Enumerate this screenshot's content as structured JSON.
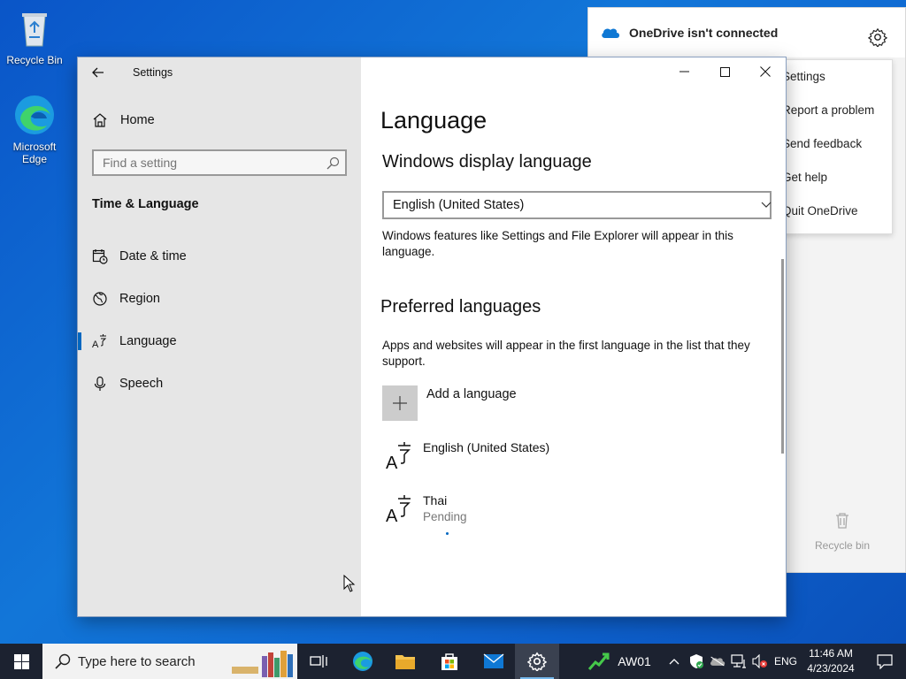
{
  "desktop": {
    "icons": [
      {
        "label": "Recycle Bin"
      },
      {
        "label_line1": "Microsoft",
        "label_line2": "Edge"
      }
    ]
  },
  "onedrive": {
    "title": "OneDrive isn't connected",
    "menu": [
      "Settings",
      "Report a problem",
      "Send feedback",
      "Get help",
      "Quit OneDrive"
    ],
    "recycle_label": "Recycle bin"
  },
  "settings": {
    "window_title": "Settings",
    "home_label": "Home",
    "search_placeholder": "Find a setting",
    "section_title": "Time & Language",
    "nav": [
      {
        "label": "Date & time",
        "icon": "calendar-clock-icon"
      },
      {
        "label": "Region",
        "icon": "globe-icon"
      },
      {
        "label": "Language",
        "icon": "language-icon",
        "active": true
      },
      {
        "label": "Speech",
        "icon": "microphone-icon"
      }
    ],
    "page_title": "Language",
    "display_language": {
      "heading": "Windows display language",
      "selected": "English (United States)",
      "description": "Windows features like Settings and File Explorer will appear in this language."
    },
    "preferred": {
      "heading": "Preferred languages",
      "description": "Apps and websites will appear in the first language in the list that they support.",
      "add_label": "Add a language",
      "languages": [
        {
          "name": "English (United States)",
          "status": ""
        },
        {
          "name": "Thai",
          "status": "Pending"
        }
      ]
    }
  },
  "taskbar": {
    "search_placeholder": "Type here to search",
    "network_label": "AW01",
    "input_lang": "ENG",
    "time": "11:46 AM",
    "date": "4/23/2024"
  },
  "colors": {
    "accent": "#0067c0",
    "taskbar": "#1c2230",
    "sidebar": "#e6e6e6"
  }
}
